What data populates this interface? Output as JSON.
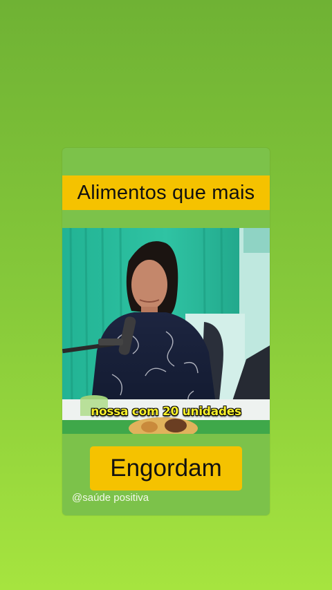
{
  "header": {
    "title": "Alimentos que mais"
  },
  "video": {
    "caption": "nossa com 20 unidades"
  },
  "footer": {
    "highlight": "Engordam",
    "handle": "@saúde positiva"
  },
  "colors": {
    "background_top": "#6fb234",
    "background_bottom": "#a6e43f",
    "card": "#7cc24a",
    "banner": "#f5c200",
    "caption": "#f7ef2a"
  }
}
